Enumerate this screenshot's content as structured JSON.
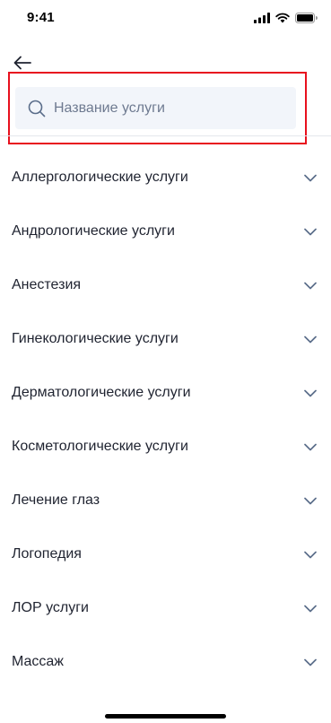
{
  "status_bar": {
    "time": "9:41"
  },
  "header": {
    "back_icon": "arrow-left-icon"
  },
  "search": {
    "placeholder": "Название услуги",
    "value": "",
    "icon": "search-icon",
    "highlight_color": "#e8101e"
  },
  "categories": [
    {
      "label": "Аллергологические услуги"
    },
    {
      "label": "Андрологические услуги"
    },
    {
      "label": "Анестезия"
    },
    {
      "label": "Гинекологические услуги"
    },
    {
      "label": "Дерматологические услуги"
    },
    {
      "label": "Косметологические услуги"
    },
    {
      "label": "Лечение глаз"
    },
    {
      "label": "Логопедия"
    },
    {
      "label": "ЛОР услуги"
    },
    {
      "label": "Массаж"
    }
  ],
  "colors": {
    "chevron": "#5a6d8a",
    "search_bg": "#f2f5fa",
    "text": "#1f2330",
    "placeholder": "#6e7a90"
  }
}
